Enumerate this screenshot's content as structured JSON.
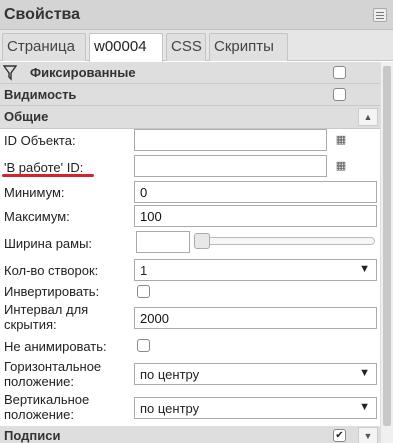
{
  "window": {
    "title": "Свойства",
    "menu_icon": "hamburger-icon"
  },
  "tabs": [
    {
      "label": "Страница",
      "active": false
    },
    {
      "label": "w00004",
      "active": true
    },
    {
      "label": "CSS",
      "active": false
    },
    {
      "label": "Скрипты",
      "active": false
    }
  ],
  "sections": {
    "fixed": {
      "label": "Фиксированные",
      "icon": "filter-icon",
      "checked": false
    },
    "visibility": {
      "label": "Видимость",
      "checked": false
    },
    "general": {
      "label": "Общие",
      "toggle_icon": "collapse-up-icon"
    },
    "captions": {
      "label": "Подписи",
      "checked": true,
      "toggle_icon": "expand-down-icon"
    }
  },
  "fields": {
    "object_id": {
      "label": "ID Объекта:",
      "value": ""
    },
    "working_id": {
      "label": "'В работе' ID:",
      "value": ""
    },
    "minimum": {
      "label": "Минимум:",
      "value": "0"
    },
    "maximum": {
      "label": "Максимум:",
      "value": "100"
    },
    "border_width": {
      "label": "Ширина рамы:",
      "value": "",
      "slider_level": 0
    },
    "leaf_count": {
      "label": "Кол-во створок:",
      "value": "1"
    },
    "invert": {
      "label": "Инвертировать:",
      "checked": false
    },
    "hide_interval": {
      "label_line1": "Интервал для",
      "label_line2": "скрытия:",
      "value": "2000"
    },
    "no_animate": {
      "label": "Не анимировать:",
      "checked": false
    },
    "h_position": {
      "label_line1": "Горизонтальное",
      "label_line2": "положение:",
      "value": "по центру"
    },
    "v_position": {
      "label_line1": "Вертикальное",
      "label_line2": "положение:",
      "value": "по центру"
    }
  },
  "colors": {
    "highlight_underline": "#d6222b",
    "section_bg": "#dedede"
  }
}
